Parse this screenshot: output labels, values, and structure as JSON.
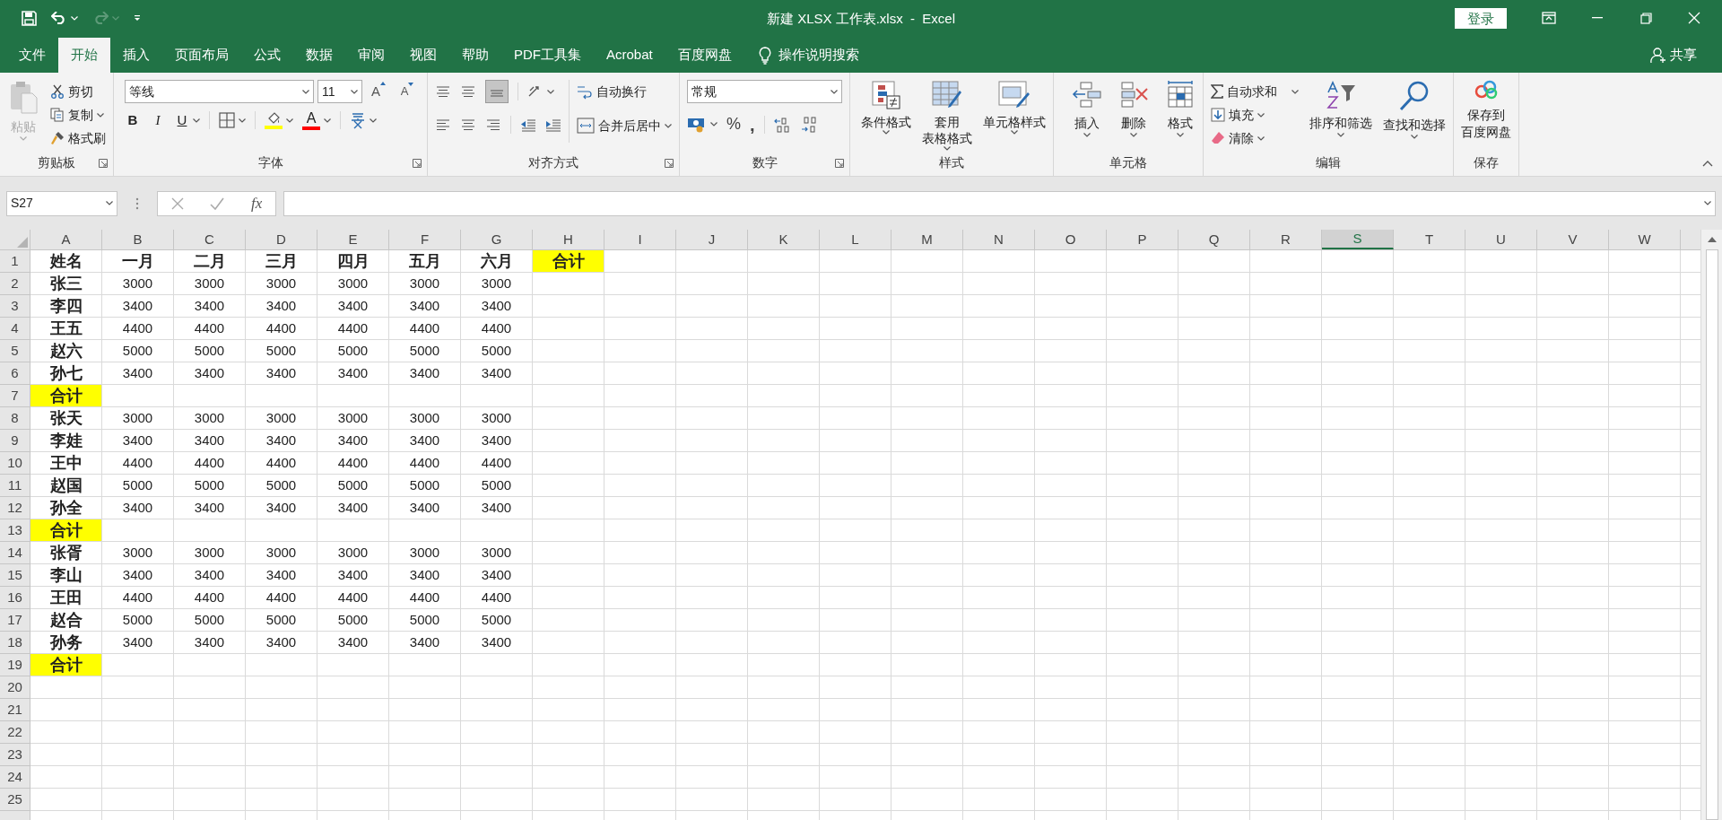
{
  "window": {
    "title": "新建 XLSX 工作表.xlsx  -  Excel",
    "login": "登录"
  },
  "tabs": [
    {
      "label": "文件",
      "selected": false
    },
    {
      "label": "开始",
      "selected": true
    },
    {
      "label": "插入",
      "selected": false
    },
    {
      "label": "页面布局",
      "selected": false
    },
    {
      "label": "公式",
      "selected": false
    },
    {
      "label": "数据",
      "selected": false
    },
    {
      "label": "审阅",
      "selected": false
    },
    {
      "label": "视图",
      "selected": false
    },
    {
      "label": "帮助",
      "selected": false
    },
    {
      "label": "PDF工具集",
      "selected": false
    },
    {
      "label": "Acrobat",
      "selected": false
    },
    {
      "label": "百度网盘",
      "selected": false
    }
  ],
  "tell_me": "操作说明搜索",
  "share": "共享",
  "ribbon": {
    "clipboard": {
      "label": "剪贴板",
      "paste": "粘贴",
      "cut": "剪切",
      "copy": "复制",
      "format_painter": "格式刷"
    },
    "font": {
      "label": "字体",
      "font_name": "等线",
      "font_size": "11",
      "grow": "A",
      "shrink": "A",
      "bold": "B",
      "italic": "I",
      "underline": "U",
      "font_color": "A"
    },
    "alignment": {
      "label": "对齐方式",
      "wrap_text": "自动换行",
      "merge_center": "合并后居中"
    },
    "number": {
      "label": "数字",
      "format": "常规",
      "percent": "%",
      "comma": ","
    },
    "styles": {
      "label": "样式",
      "buttons": [
        [
          "条件格式"
        ],
        [
          "套用",
          "表格格式"
        ],
        [
          "单元格样式"
        ]
      ]
    },
    "cells": {
      "label": "单元格",
      "buttons": [
        "插入",
        "删除",
        "格式"
      ]
    },
    "editing": {
      "label": "编辑",
      "autosum": "自动求和",
      "fill": "填充",
      "clear": "清除",
      "sort_filter": "排序和筛选",
      "find_select": "查找和选择"
    },
    "save": {
      "label": "保存",
      "button": [
        "保存到",
        "百度网盘"
      ]
    }
  },
  "formula_bar": {
    "name_box": "S27",
    "fx": "fx"
  },
  "sheet": {
    "columns": [
      {
        "label": "A",
        "selected": false
      },
      {
        "label": "B",
        "selected": false
      },
      {
        "label": "C",
        "selected": false
      },
      {
        "label": "D",
        "selected": false
      },
      {
        "label": "E",
        "selected": false
      },
      {
        "label": "F",
        "selected": false
      },
      {
        "label": "G",
        "selected": false
      },
      {
        "label": "H",
        "selected": false
      },
      {
        "label": "I",
        "selected": false
      },
      {
        "label": "J",
        "selected": false
      },
      {
        "label": "K",
        "selected": false
      },
      {
        "label": "L",
        "selected": false
      },
      {
        "label": "M",
        "selected": false
      },
      {
        "label": "N",
        "selected": false
      },
      {
        "label": "O",
        "selected": false
      },
      {
        "label": "P",
        "selected": false
      },
      {
        "label": "Q",
        "selected": false
      },
      {
        "label": "R",
        "selected": false
      },
      {
        "label": "S",
        "selected": true
      },
      {
        "label": "T",
        "selected": false
      },
      {
        "label": "U",
        "selected": false
      },
      {
        "label": "V",
        "selected": false
      },
      {
        "label": "W",
        "selected": false
      }
    ],
    "rows": [
      {
        "header": "1",
        "cells": [
          {
            "text": "姓名",
            "bold": true
          },
          {
            "text": "一月",
            "bold": true
          },
          {
            "text": "二月",
            "bold": true
          },
          {
            "text": "三月",
            "bold": true
          },
          {
            "text": "四月",
            "bold": true
          },
          {
            "text": "五月",
            "bold": true
          },
          {
            "text": "六月",
            "bold": true
          },
          {
            "text": "合计",
            "bold": true,
            "color": "#ffff00"
          }
        ]
      },
      {
        "header": "2",
        "cells": [
          {
            "text": "张三",
            "bold": true
          },
          {
            "text": "3000",
            "bold": false
          },
          {
            "text": "3000",
            "bold": false
          },
          {
            "text": "3000",
            "bold": false
          },
          {
            "text": "3000",
            "bold": false
          },
          {
            "text": "3000",
            "bold": false
          },
          {
            "text": "3000",
            "bold": false
          }
        ]
      },
      {
        "header": "3",
        "cells": [
          {
            "text": "李四",
            "bold": true
          },
          {
            "text": "3400",
            "bold": false
          },
          {
            "text": "3400",
            "bold": false
          },
          {
            "text": "3400",
            "bold": false
          },
          {
            "text": "3400",
            "bold": false
          },
          {
            "text": "3400",
            "bold": false
          },
          {
            "text": "3400",
            "bold": false
          }
        ]
      },
      {
        "header": "4",
        "cells": [
          {
            "text": "王五",
            "bold": true
          },
          {
            "text": "4400",
            "bold": false
          },
          {
            "text": "4400",
            "bold": false
          },
          {
            "text": "4400",
            "bold": false
          },
          {
            "text": "4400",
            "bold": false
          },
          {
            "text": "4400",
            "bold": false
          },
          {
            "text": "4400",
            "bold": false
          }
        ]
      },
      {
        "header": "5",
        "cells": [
          {
            "text": "赵六",
            "bold": true
          },
          {
            "text": "5000",
            "bold": false
          },
          {
            "text": "5000",
            "bold": false
          },
          {
            "text": "5000",
            "bold": false
          },
          {
            "text": "5000",
            "bold": false
          },
          {
            "text": "5000",
            "bold": false
          },
          {
            "text": "5000",
            "bold": false
          }
        ]
      },
      {
        "header": "6",
        "cells": [
          {
            "text": "孙七",
            "bold": true
          },
          {
            "text": "3400",
            "bold": false
          },
          {
            "text": "3400",
            "bold": false
          },
          {
            "text": "3400",
            "bold": false
          },
          {
            "text": "3400",
            "bold": false
          },
          {
            "text": "3400",
            "bold": false
          },
          {
            "text": "3400",
            "bold": false
          }
        ]
      },
      {
        "header": "7",
        "cells": [
          {
            "text": "合计",
            "bold": true,
            "color": "#ffff00"
          }
        ]
      },
      {
        "header": "8",
        "cells": [
          {
            "text": "张天",
            "bold": true
          },
          {
            "text": "3000",
            "bold": false
          },
          {
            "text": "3000",
            "bold": false
          },
          {
            "text": "3000",
            "bold": false
          },
          {
            "text": "3000",
            "bold": false
          },
          {
            "text": "3000",
            "bold": false
          },
          {
            "text": "3000",
            "bold": false
          }
        ]
      },
      {
        "header": "9",
        "cells": [
          {
            "text": "李娃",
            "bold": true
          },
          {
            "text": "3400",
            "bold": false
          },
          {
            "text": "3400",
            "bold": false
          },
          {
            "text": "3400",
            "bold": false
          },
          {
            "text": "3400",
            "bold": false
          },
          {
            "text": "3400",
            "bold": false
          },
          {
            "text": "3400",
            "bold": false
          }
        ]
      },
      {
        "header": "10",
        "cells": [
          {
            "text": "王中",
            "bold": true
          },
          {
            "text": "4400",
            "bold": false
          },
          {
            "text": "4400",
            "bold": false
          },
          {
            "text": "4400",
            "bold": false
          },
          {
            "text": "4400",
            "bold": false
          },
          {
            "text": "4400",
            "bold": false
          },
          {
            "text": "4400",
            "bold": false
          }
        ]
      },
      {
        "header": "11",
        "cells": [
          {
            "text": "赵国",
            "bold": true
          },
          {
            "text": "5000",
            "bold": false
          },
          {
            "text": "5000",
            "bold": false
          },
          {
            "text": "5000",
            "bold": false
          },
          {
            "text": "5000",
            "bold": false
          },
          {
            "text": "5000",
            "bold": false
          },
          {
            "text": "5000",
            "bold": false
          }
        ]
      },
      {
        "header": "12",
        "cells": [
          {
            "text": "孙全",
            "bold": true
          },
          {
            "text": "3400",
            "bold": false
          },
          {
            "text": "3400",
            "bold": false
          },
          {
            "text": "3400",
            "bold": false
          },
          {
            "text": "3400",
            "bold": false
          },
          {
            "text": "3400",
            "bold": false
          },
          {
            "text": "3400",
            "bold": false
          }
        ]
      },
      {
        "header": "13",
        "cells": [
          {
            "text": "合计",
            "bold": true,
            "color": "#ffff00"
          }
        ]
      },
      {
        "header": "14",
        "cells": [
          {
            "text": "张胥",
            "bold": true
          },
          {
            "text": "3000",
            "bold": false
          },
          {
            "text": "3000",
            "bold": false
          },
          {
            "text": "3000",
            "bold": false
          },
          {
            "text": "3000",
            "bold": false
          },
          {
            "text": "3000",
            "bold": false
          },
          {
            "text": "3000",
            "bold": false
          }
        ]
      },
      {
        "header": "15",
        "cells": [
          {
            "text": "李山",
            "bold": true
          },
          {
            "text": "3400",
            "bold": false
          },
          {
            "text": "3400",
            "bold": false
          },
          {
            "text": "3400",
            "bold": false
          },
          {
            "text": "3400",
            "bold": false
          },
          {
            "text": "3400",
            "bold": false
          },
          {
            "text": "3400",
            "bold": false
          }
        ]
      },
      {
        "header": "16",
        "cells": [
          {
            "text": "王田",
            "bold": true
          },
          {
            "text": "4400",
            "bold": false
          },
          {
            "text": "4400",
            "bold": false
          },
          {
            "text": "4400",
            "bold": false
          },
          {
            "text": "4400",
            "bold": false
          },
          {
            "text": "4400",
            "bold": false
          },
          {
            "text": "4400",
            "bold": false
          }
        ]
      },
      {
        "header": "17",
        "cells": [
          {
            "text": "赵合",
            "bold": true
          },
          {
            "text": "5000",
            "bold": false
          },
          {
            "text": "5000",
            "bold": false
          },
          {
            "text": "5000",
            "bold": false
          },
          {
            "text": "5000",
            "bold": false
          },
          {
            "text": "5000",
            "bold": false
          },
          {
            "text": "5000",
            "bold": false
          }
        ]
      },
      {
        "header": "18",
        "cells": [
          {
            "text": "孙务",
            "bold": true
          },
          {
            "text": "3400",
            "bold": false
          },
          {
            "text": "3400",
            "bold": false
          },
          {
            "text": "3400",
            "bold": false
          },
          {
            "text": "3400",
            "bold": false
          },
          {
            "text": "3400",
            "bold": false
          },
          {
            "text": "3400",
            "bold": false
          }
        ]
      },
      {
        "header": "19",
        "cells": [
          {
            "text": "合计",
            "bold": true,
            "color": "#ffff00"
          }
        ]
      },
      {
        "header": "20"
      },
      {
        "header": "21"
      },
      {
        "header": "22"
      },
      {
        "header": "23"
      },
      {
        "header": "24"
      },
      {
        "header": "25"
      }
    ]
  }
}
